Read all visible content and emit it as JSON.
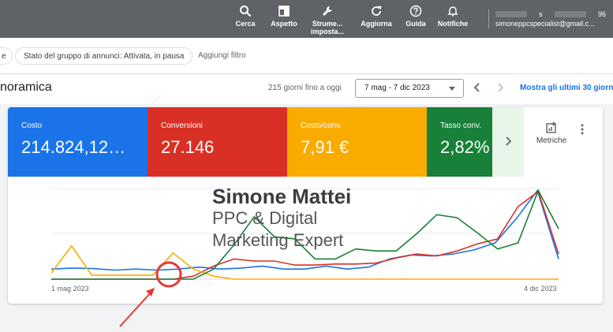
{
  "toolbar": {
    "items": [
      {
        "label": "Cerca",
        "icon": "search-icon"
      },
      {
        "label": "Aspetto",
        "icon": "appearance-icon"
      },
      {
        "label": "Strume... imposta...",
        "icon": "wrench-icon"
      },
      {
        "label": "Aggiorna",
        "icon": "refresh-icon"
      },
      {
        "label": "Guida",
        "icon": "help-icon"
      },
      {
        "label": "Notifiche",
        "icon": "bell-icon"
      }
    ],
    "account_id_suffix": "96",
    "account_letter": "s",
    "account_email": "simoneppcspecialist@gmail.c..."
  },
  "filters": {
    "chip_cut": "e",
    "chip_status": "Stato del gruppo di annunci: Attivata, in pausa",
    "add_filter": "Aggiungi filtro"
  },
  "header": {
    "title": "noramica",
    "days": "215 giorni fino a oggi",
    "date_range": "7 mag - 7 dic 2023",
    "show_last": "Mostra gli ultimi 30 giorni"
  },
  "metrics": [
    {
      "label": "Costo",
      "value": "214.824,12…",
      "color": "#1a73e8"
    },
    {
      "label": "Conversioni",
      "value": "27.146",
      "color": "#d93025"
    },
    {
      "label": "Costo/conv.",
      "value": "7,91 €",
      "color": "#f9ab00"
    },
    {
      "label": "Tasso conv.",
      "value": "2,82%",
      "color": "#188038"
    }
  ],
  "metriche_label": "Metriche",
  "chart_data": {
    "type": "line",
    "x_labels": [
      "1 mag 2023",
      "4 dic 2023"
    ],
    "series": [
      {
        "color": "#1a73e8",
        "values": [
          1.0,
          1.1,
          1.05,
          0.9,
          1.0,
          0.9,
          1.0,
          1.2,
          1.0,
          1.1,
          1.3,
          1.0,
          1.0,
          1.3,
          1.0,
          1.2,
          2.0,
          2.4,
          2.3,
          2.5,
          2.9,
          3.6,
          6.0,
          8.8,
          2.0
        ]
      },
      {
        "color": "#d93025",
        "values": [
          0.0,
          0.0,
          0.0,
          0.0,
          0.0,
          0.0,
          0.0,
          0.3,
          1.3,
          2.0,
          1.8,
          1.8,
          1.4,
          1.4,
          1.5,
          1.5,
          1.6,
          2.1,
          2.5,
          2.3,
          2.8,
          3.5,
          4.0,
          7.2,
          8.7,
          2.5
        ]
      },
      {
        "color": "#f9ab00",
        "values": [
          0.6,
          3.3,
          0.4,
          0.4,
          0.4,
          0.4,
          2.6,
          1.0,
          0.3,
          0.0,
          0.0,
          0.0,
          0.0,
          0.0,
          0.0,
          0.0,
          0.0,
          0.0,
          0.0,
          0.0,
          0.0,
          0.0,
          0.0,
          0.0,
          0.0,
          0.0
        ]
      },
      {
        "color": "#188038",
        "values": [
          0.0,
          0.0,
          0.0,
          0.0,
          0.0,
          0.0,
          0.0,
          0.0,
          1.0,
          3.4,
          6.2,
          4.2,
          4.0,
          2.0,
          2.0,
          3.0,
          2.8,
          2.8,
          4.5,
          6.4,
          6.1,
          4.6,
          3.0,
          3.6,
          8.8,
          5.0
        ]
      }
    ]
  },
  "watermark": {
    "name": "Simone Mattei",
    "line1": "PPC & Digital",
    "line2": "Marketing Expert"
  }
}
